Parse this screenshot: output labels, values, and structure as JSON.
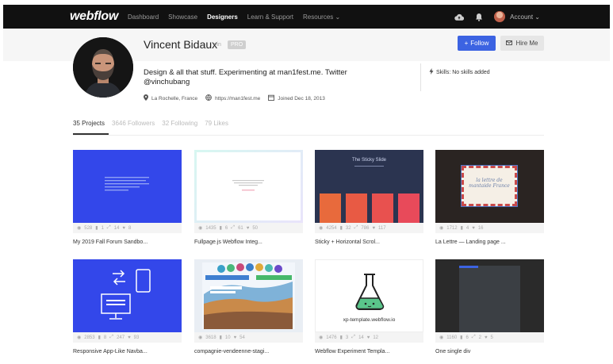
{
  "nav": {
    "logo": "webflow",
    "links": [
      "Dashboard",
      "Showcase",
      "Designers",
      "Learn & Support",
      "Resources ⌄"
    ],
    "account": "Account ⌄"
  },
  "profile": {
    "name": "Vincent Bidaux",
    "handle": "vin",
    "badge": "PRO",
    "follow_label": "Follow",
    "hire_label": "Hire Me",
    "bio": "Design & all that stuff. Experimenting at man1fest.me. Twitter @vinchubang",
    "location": "La Rochelle, France",
    "website": "https://man1fest.me",
    "joined": "Joined Dec 18, 2013",
    "skills": "Skills: No skills added"
  },
  "stats": {
    "projects": "35 Projects",
    "followers": "3646 Followers",
    "following": "32 Following",
    "likes": "79 Likes"
  },
  "projects": [
    {
      "title": "My 2019 Fall Forum Sandbo...",
      "stats": [
        "528",
        "1",
        "14",
        "8"
      ]
    },
    {
      "title": "Fullpage.js Webflow Integ...",
      "stats": [
        "1435",
        "6",
        "61",
        "50"
      ]
    },
    {
      "title": "Sticky + Horizontal Scrol...",
      "stats": [
        "4254",
        "32",
        "786",
        "117"
      ]
    },
    {
      "title": "La Lettre — Landing page ...",
      "stats": [
        "1712",
        "4",
        "16"
      ]
    },
    {
      "title": "Responsive App-Like Navba...",
      "stats": [
        "2853",
        "8",
        "247",
        "93"
      ]
    },
    {
      "title": "compagnie-vendeenne-stagi...",
      "stats": [
        "3618",
        "10",
        "54"
      ]
    },
    {
      "title": "Webflow Experiment Templa...",
      "stats": [
        "1476",
        "3",
        "14",
        "12"
      ]
    },
    {
      "title": "One single div",
      "stats": [
        "1160",
        "6",
        "2",
        "5"
      ]
    }
  ],
  "thumb_text": {
    "sticky": "The Sticky Slide",
    "lettre": "la lettre de mantaide France",
    "xp": "xp-template.webflow.io"
  },
  "colors": {
    "accent": "#3c63e2",
    "nav_bg": "#111111",
    "blue_thumb": "#3347ea"
  }
}
